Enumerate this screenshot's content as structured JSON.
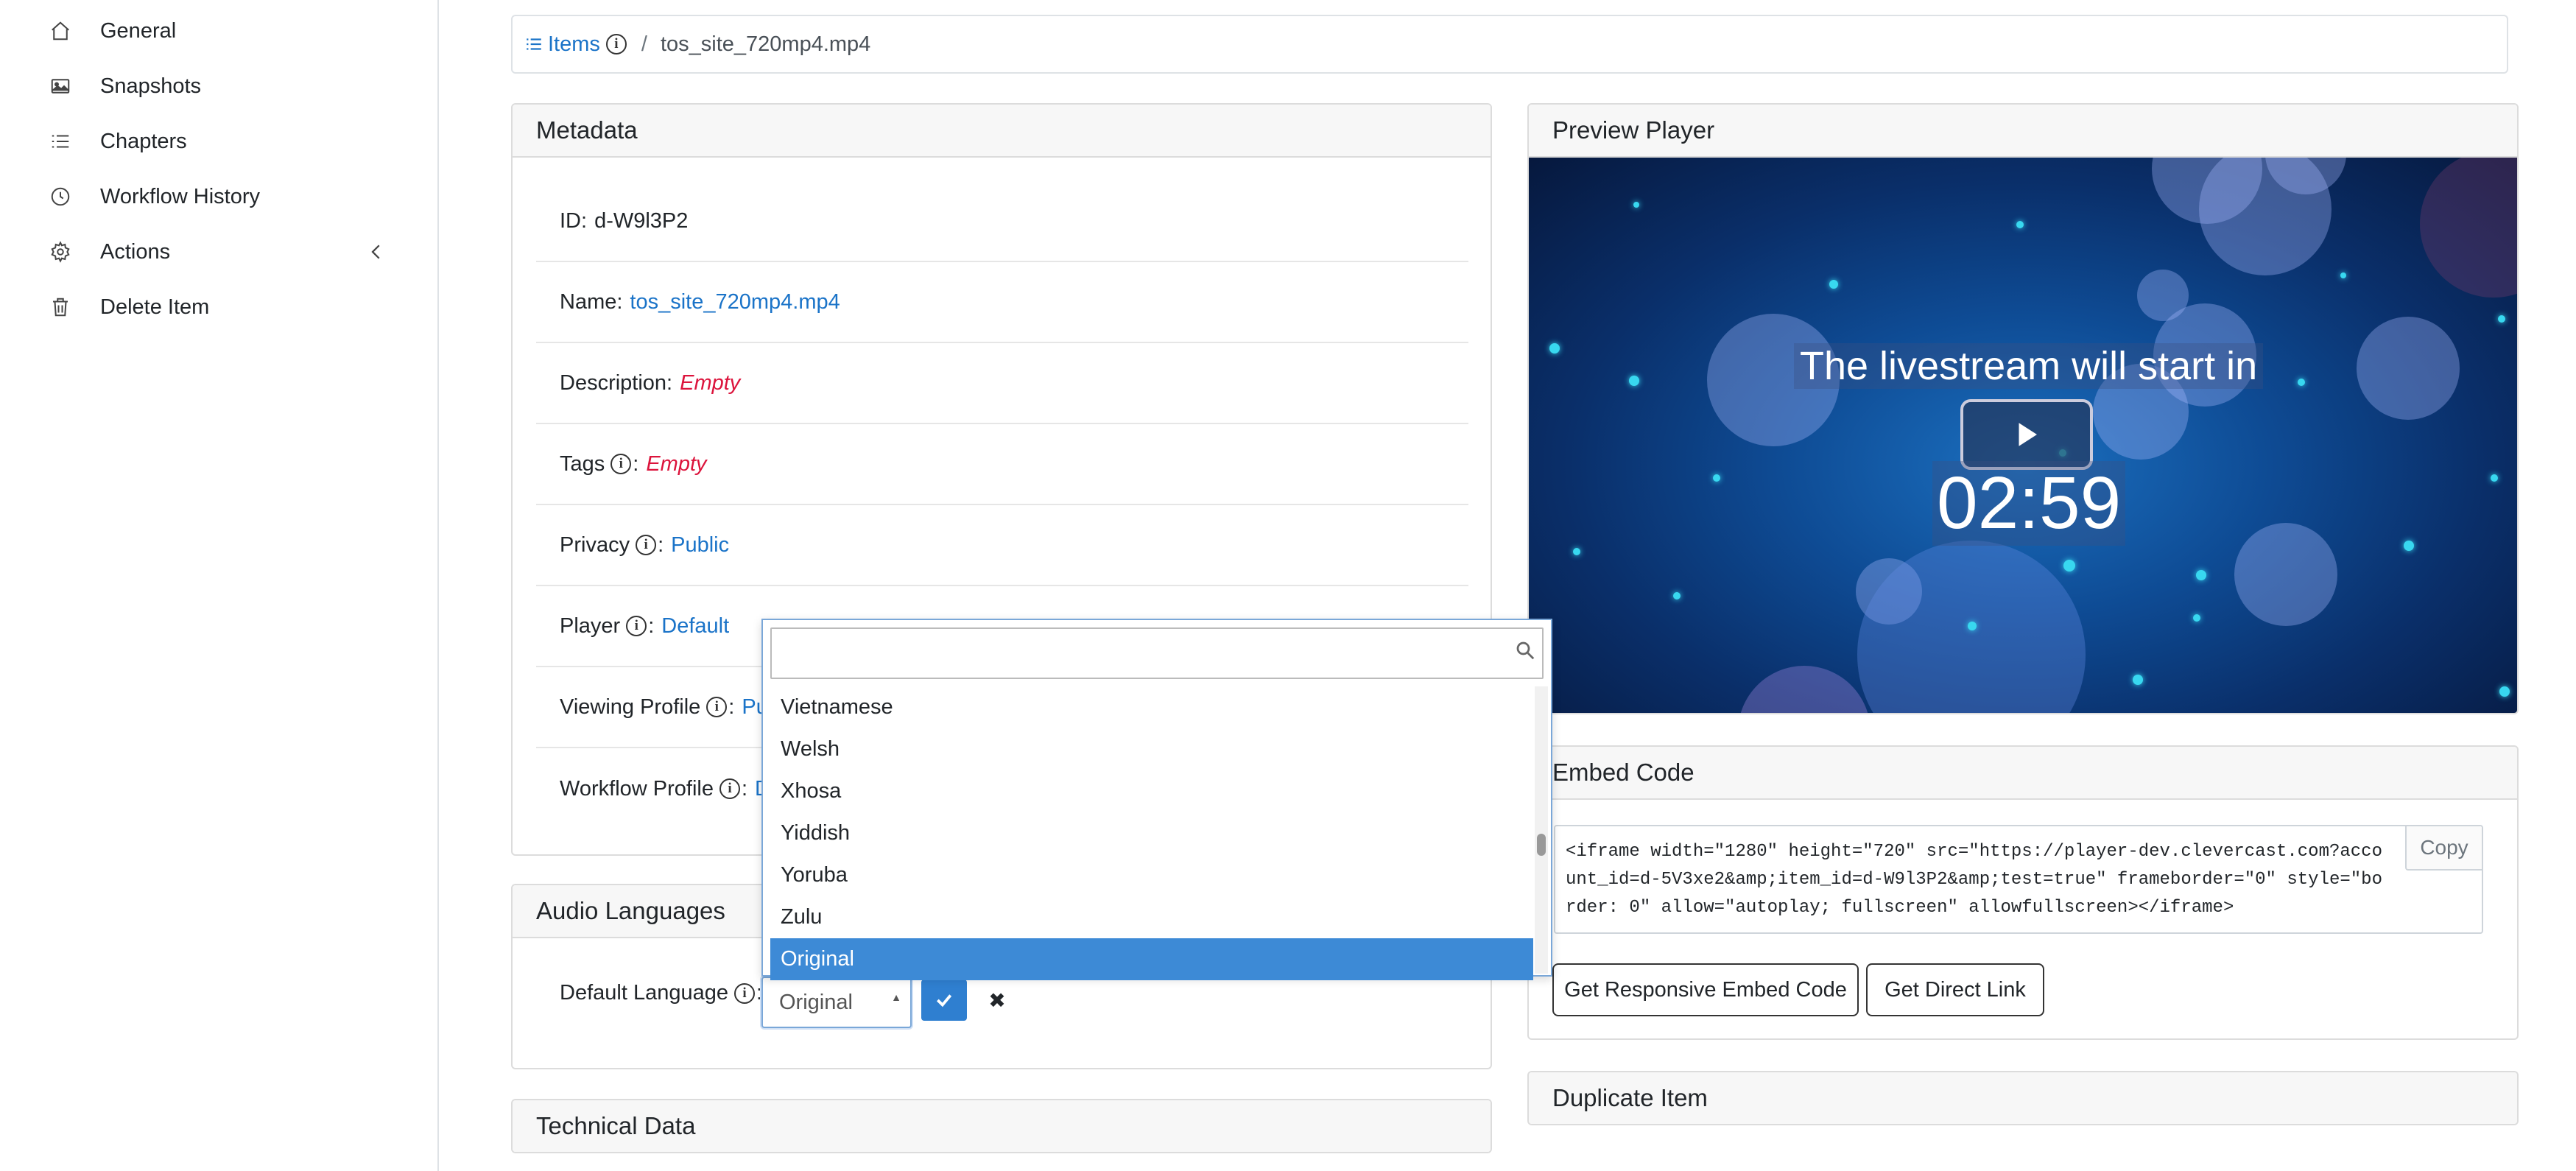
{
  "sidebar": {
    "items": [
      {
        "label": "General",
        "icon": "home-icon"
      },
      {
        "label": "Snapshots",
        "icon": "image-icon"
      },
      {
        "label": "Chapters",
        "icon": "list-icon"
      },
      {
        "label": "Workflow History",
        "icon": "clock-icon"
      },
      {
        "label": "Actions",
        "icon": "gear-icon"
      },
      {
        "label": "Delete Item",
        "icon": "trash-icon"
      }
    ]
  },
  "breadcrumb": {
    "items_label": "Items",
    "separator": "/",
    "current": "tos_site_720mp4.mp4"
  },
  "metadata": {
    "title": "Metadata",
    "id_label": "ID:",
    "id_value": "d-W9l3P2",
    "name_label": "Name:",
    "name_value": "tos_site_720mp4.mp4",
    "description_label": "Description:",
    "description_value": "Empty",
    "tags_label": "Tags",
    "tags_value": "Empty",
    "privacy_label": "Privacy",
    "privacy_value": "Public",
    "player_label": "Player",
    "player_value": "Default",
    "viewing_profile_label": "Viewing Profile",
    "viewing_profile_value": "Pu",
    "workflow_profile_label": "Workflow Profile",
    "workflow_profile_value": "D",
    "colon": ":"
  },
  "audio": {
    "title": "Audio Languages",
    "default_language_label": "Default Language",
    "selected_value": "Original"
  },
  "technical": {
    "title": "Technical Data"
  },
  "preview": {
    "title": "Preview Player",
    "video_title": "The livestream will start in",
    "countdown": "02:59"
  },
  "embed": {
    "title": "Embed Code",
    "code": "<iframe width=\"1280\" height=\"720\" src=\"https://player-dev.clevercast.com?account_id=d-5V3xe2&amp;item_id=d-W9l3P2&amp;test=true\" frameborder=\"0\" style=\"border: 0\" allow=\"autoplay; fullscreen\" allowfullscreen></iframe>",
    "copy_label": "Copy",
    "responsive_label": "Get Responsive Embed Code",
    "direct_label": "Get Direct Link"
  },
  "duplicate": {
    "title": "Duplicate Item"
  },
  "dropdown": {
    "search_value": "",
    "options": [
      "Vietnamese",
      "Welsh",
      "Xhosa",
      "Yiddish",
      "Yoruba",
      "Zulu",
      "Original"
    ],
    "selected": "Original"
  },
  "colors": {
    "link": "#1a73c8",
    "empty": "#dc143c",
    "selected_bg": "#3d8ad6"
  }
}
